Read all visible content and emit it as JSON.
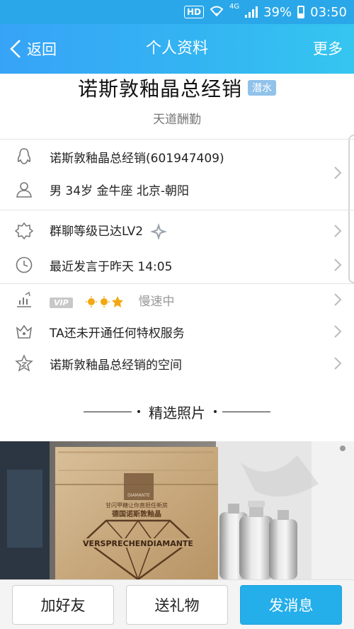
{
  "status_bar": {
    "hd": "HD",
    "network": "4G",
    "battery": "39%",
    "time": "03:50"
  },
  "title_bar": {
    "back_label": "返回",
    "title": "个人资料",
    "more_label": "更多"
  },
  "profile": {
    "name": "诺斯敦釉晶总经销",
    "badge": "潜水",
    "signature": "天道酬勤"
  },
  "info": {
    "qq": "诺斯敦釉晶总经销(601947409)",
    "details": "男  34岁  金牛座  北京-朝阳"
  },
  "group_info": {
    "level": "群聊等级已达LV2",
    "last_speak": "最近发言于昨天 14:05"
  },
  "vip_info": {
    "vip_label": "VIP",
    "speed": "慢速中",
    "privilege": "TA还未开通任何特权服务",
    "space": "诺斯敦釉晶总经销的空间"
  },
  "photos": {
    "heading": "精选照片",
    "box_brand": "VERSPRECHENDIAMANTE",
    "box_line1": "甘闪甲糖让你直担任新房",
    "box_line2": "德国诺斯敦釉晶",
    "box_small": "DIAMANTE"
  },
  "actions": {
    "add_friend": "加好友",
    "send_gift": "送礼物",
    "send_message": "发消息"
  },
  "colors": {
    "accent": "#24aeea",
    "title_gradient_start": "#37a3f7",
    "title_gradient_end": "#35c6f0"
  }
}
